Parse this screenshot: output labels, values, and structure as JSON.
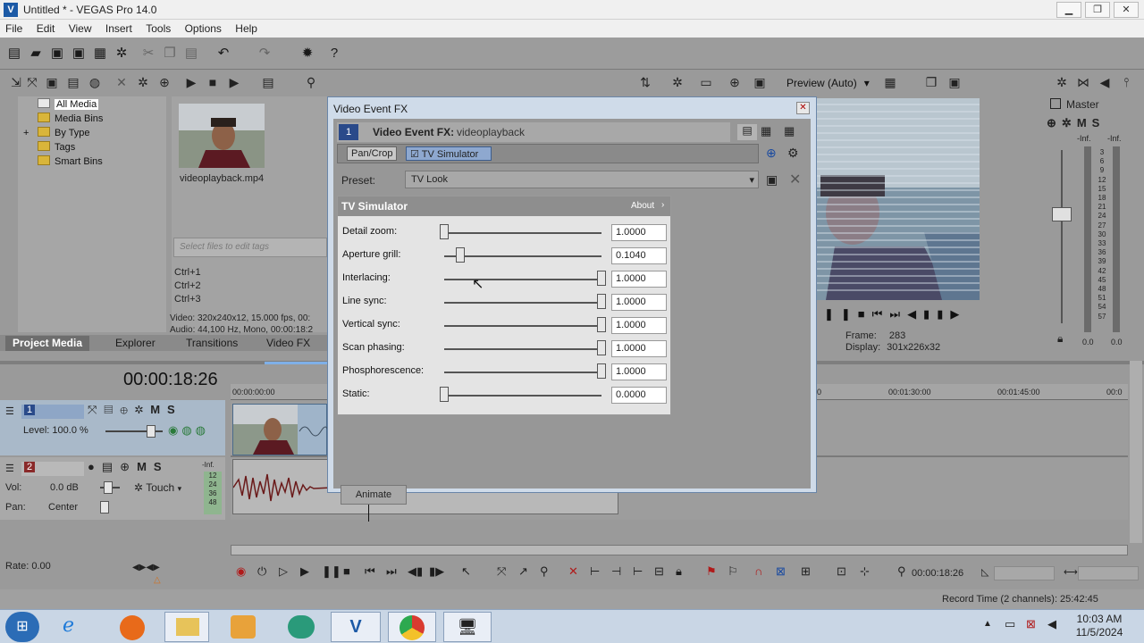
{
  "window": {
    "title": "Untitled * - VEGAS Pro 14.0",
    "logo_letter": "V",
    "minimize": "▁",
    "maximize": "❐",
    "close": "✕"
  },
  "menu": [
    "File",
    "Edit",
    "View",
    "Insert",
    "Tools",
    "Options",
    "Help"
  ],
  "explorer": {
    "tree": [
      {
        "label": "All Media",
        "selected": true
      },
      {
        "label": "Media Bins"
      },
      {
        "label": "By Type",
        "expand": "+"
      },
      {
        "label": "Tags"
      },
      {
        "label": "Smart Bins"
      }
    ],
    "media_file": "videoplayback.mp4",
    "tags_placeholder": "Select files to edit tags",
    "shortcuts": [
      "Ctrl+1",
      "Ctrl+2",
      "Ctrl+3"
    ],
    "info_video": "Video: 320x240x12, 15.000 fps, 00:",
    "info_audio": "Audio: 44,100 Hz, Mono, 00:00:18:2",
    "tabs": [
      "Project Media",
      "Explorer",
      "Transitions",
      "Video FX"
    ]
  },
  "preview": {
    "mode": "Preview (Auto)",
    "frame_label": "Frame:",
    "frame_value": "283",
    "display_label": "Display:",
    "display_value": "301x226x32"
  },
  "master": {
    "label": "Master",
    "m": "M",
    "s": "S",
    "inf_left": "-Inf.",
    "inf_right": "-Inf.",
    "scale": [
      "3",
      "6",
      "9",
      "12",
      "15",
      "18",
      "21",
      "24",
      "27",
      "30",
      "33",
      "36",
      "39",
      "42",
      "45",
      "48",
      "51",
      "54",
      "57"
    ],
    "bottom_left": "0.0",
    "bottom_right": "0.0"
  },
  "dialog": {
    "title": "Video Event FX",
    "chain_label": "Video Event FX:",
    "chain_target": "videoplayback",
    "badge": "1",
    "plugins": [
      "Pan/Crop",
      "TV Simulator"
    ],
    "preset_label": "Preset:",
    "preset_value": "TV Look",
    "panel_title": "TV Simulator",
    "about": "About",
    "params": [
      {
        "label": "Detail zoom:",
        "value": "1.0000",
        "level": 0.0
      },
      {
        "label": "Aperture grill:",
        "value": "0.1040",
        "level": 0.104
      },
      {
        "label": "Interlacing:",
        "value": "1.0000",
        "level": 1.0
      },
      {
        "label": "Line sync:",
        "value": "1.0000",
        "level": 1.0
      },
      {
        "label": "Vertical sync:",
        "value": "1.0000",
        "level": 1.0
      },
      {
        "label": "Scan phasing:",
        "value": "1.0000",
        "level": 1.0
      },
      {
        "label": "Phosphorescence:",
        "value": "1.0000",
        "level": 1.0
      },
      {
        "label": "Static:",
        "value": "0.0000",
        "level": 0.0
      }
    ],
    "animate": "Animate"
  },
  "timeline": {
    "timecode": "00:00:18:26",
    "ruler": [
      "00:00:00:00",
      "0",
      "00:01:30:00",
      "00:01:45:00",
      "00:0"
    ],
    "track1": {
      "num": "1",
      "level": "Level: 100.0 %",
      "m": "M",
      "s": "S"
    },
    "track2": {
      "num": "2",
      "vol_label": "Vol:",
      "vol_value": "0.0 dB",
      "pan_label": "Pan:",
      "pan_value": "Center",
      "touch": "Touch",
      "m": "M",
      "s": "S",
      "inf": "-Inf.",
      "meter": [
        "12",
        "24",
        "36",
        "48"
      ]
    },
    "rate": "Rate: 0.00",
    "cursor_time": "00:00:18:26"
  },
  "status": {
    "record_time": "Record Time (2 channels): 25:42:45"
  },
  "taskbar": {
    "time": "10:03 AM",
    "date": "11/5/2024"
  },
  "colors": {
    "dialog_frame": "#cfdbe9",
    "dark_gray": "#979797",
    "selection_blue": "#7f9bc9"
  }
}
